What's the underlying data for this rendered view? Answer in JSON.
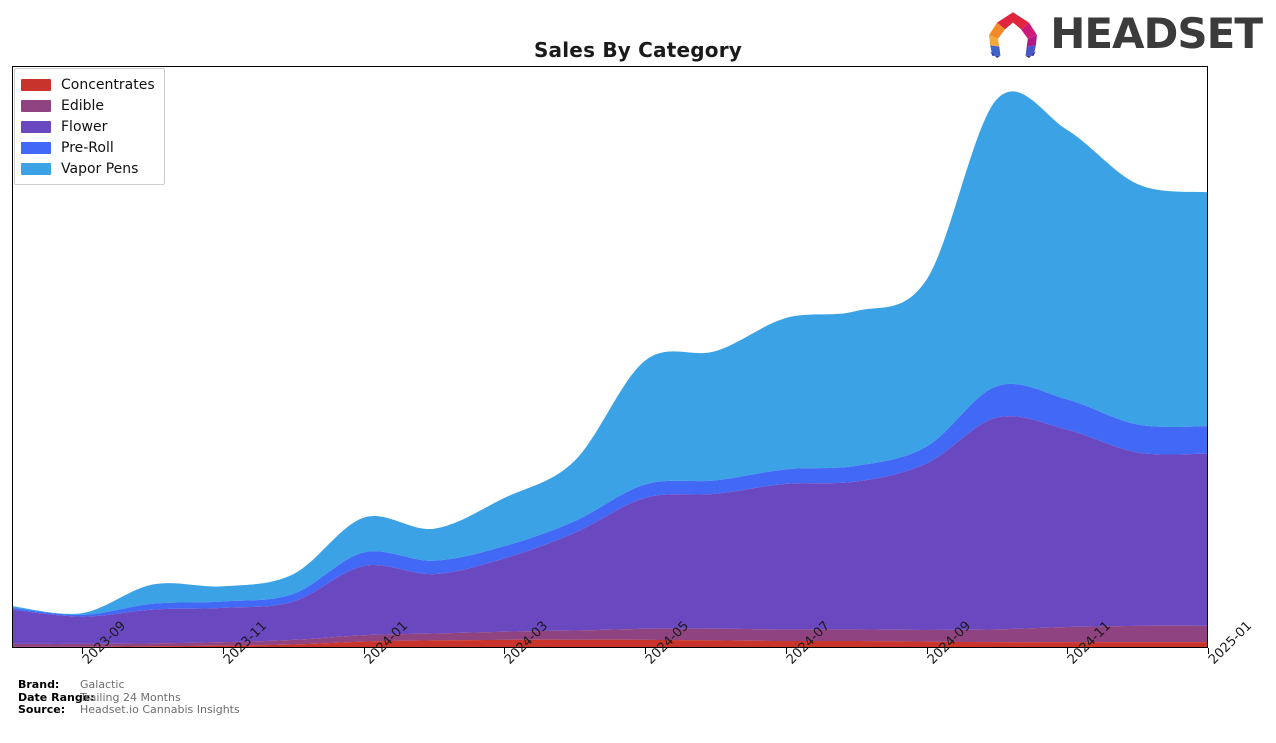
{
  "header": {
    "title": "Sales By Category",
    "logo_text": "HEADSET",
    "logo_icon": "headset-ring-logo"
  },
  "legend": {
    "position": "top-left",
    "items": [
      {
        "label": "Concentrates",
        "color": "#c8342b"
      },
      {
        "label": "Edible",
        "color": "#8f4380"
      },
      {
        "label": "Flower",
        "color": "#6a48c0"
      },
      {
        "label": "Pre-Roll",
        "color": "#4169f5"
      },
      {
        "label": "Vapor Pens",
        "color": "#3ba3e5"
      }
    ]
  },
  "footer": {
    "rows": [
      {
        "key": "Brand:",
        "value": "Galactic"
      },
      {
        "key": "Date Range:",
        "value": "Trailing 24 Months"
      },
      {
        "key": "Source:",
        "value": "Headset.io Cannabis Insights"
      }
    ]
  },
  "chart_data": {
    "type": "area",
    "stacked": true,
    "smoothing": "spline",
    "title": "Sales By Category",
    "xlabel": "",
    "ylabel": "",
    "grid": false,
    "axis_ticks_visible": {
      "x": true,
      "y": false
    },
    "legend_position": "top-left",
    "x": [
      "2023-08",
      "2023-09",
      "2023-10",
      "2023-11",
      "2023-12",
      "2024-01",
      "2024-02",
      "2024-03",
      "2024-04",
      "2024-05",
      "2024-06",
      "2024-07",
      "2024-08",
      "2024-09",
      "2024-10",
      "2024-11",
      "2024-12",
      "2025-01"
    ],
    "xtick_labels": [
      "2023-09",
      "2023-11",
      "2024-01",
      "2024-03",
      "2024-05",
      "2024-07",
      "2024-09",
      "2024-11",
      "2025-01"
    ],
    "xtick_positions": [
      "2023-09",
      "2023-11",
      "2024-01",
      "2024-03",
      "2024-05",
      "2024-07",
      "2024-09",
      "2024-11",
      "2025-01"
    ],
    "ylim": [
      0,
      100
    ],
    "series": [
      {
        "name": "Concentrates",
        "color": "#c8342b",
        "values": [
          0.2,
          0.2,
          0.3,
          0.4,
          0.6,
          1.1,
          1.3,
          1.4,
          1.4,
          1.4,
          1.3,
          1.2,
          1.2,
          1.1,
          1.0,
          1.0,
          1.0,
          1.0
        ]
      },
      {
        "name": "Edible",
        "color": "#8f4380",
        "values": [
          0.5,
          0.5,
          0.5,
          0.6,
          0.8,
          1.1,
          1.2,
          1.4,
          1.6,
          1.9,
          2.0,
          2.0,
          2.0,
          2.0,
          2.2,
          2.6,
          2.8,
          2.8
        ]
      },
      {
        "name": "Flower",
        "color": "#6a48c0",
        "values": [
          5.9,
          4.7,
          5.8,
          5.9,
          6.6,
          11.9,
          10.2,
          12.6,
          16.8,
          22.5,
          23.2,
          25.0,
          25.4,
          28.6,
          36.4,
          33.9,
          29.8,
          29.6
        ]
      },
      {
        "name": "Pre-Roll",
        "color": "#4169f5",
        "values": [
          0.3,
          0.3,
          1.0,
          1.1,
          1.3,
          2.3,
          2.3,
          2.1,
          2.0,
          2.3,
          2.3,
          2.5,
          2.7,
          2.9,
          5.4,
          5.2,
          4.8,
          4.7
        ]
      },
      {
        "name": "Vapor Pens",
        "color": "#3ba3e5",
        "values": [
          0.3,
          0.3,
          3.3,
          2.6,
          3.4,
          6.0,
          5.5,
          8.3,
          10.4,
          21.3,
          22.2,
          26.0,
          26.6,
          28.7,
          49.3,
          46.3,
          41.3,
          40.2
        ]
      }
    ]
  }
}
